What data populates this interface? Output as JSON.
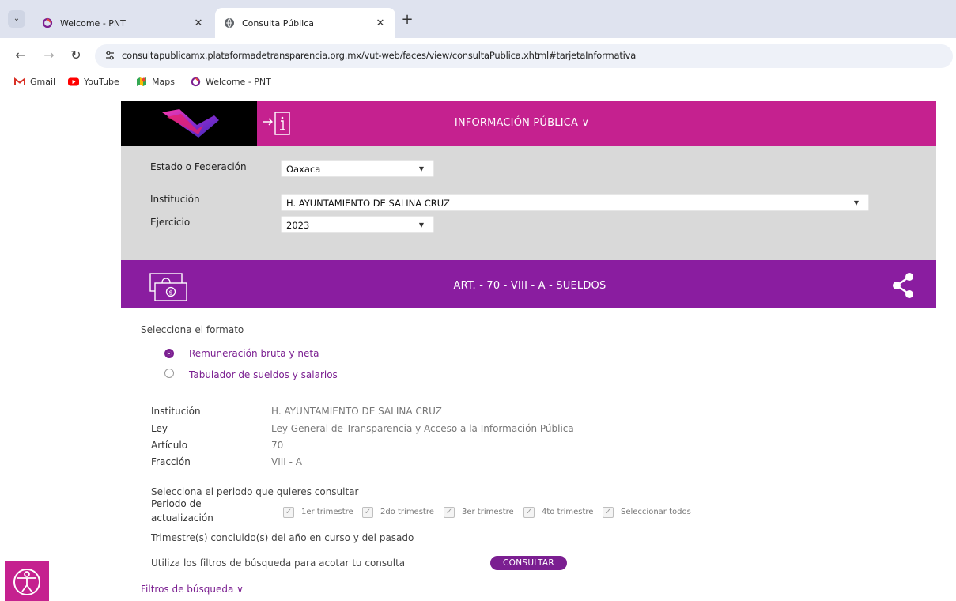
{
  "browser": {
    "tabs": [
      {
        "title": "Welcome - PNT",
        "active": false
      },
      {
        "title": "Consulta Pública",
        "active": true
      }
    ],
    "new_tab": "+",
    "url": "consultapublicamx.plataformadetransparencia.org.mx/vut-web/faces/view/consultaPublica.xhtml#tarjetaInformativa",
    "bookmarks": [
      "Gmail",
      "YouTube",
      "Maps",
      "Welcome - PNT"
    ]
  },
  "header": {
    "title": "INFORMACIÓN PÚBLICA ∨"
  },
  "filters": {
    "estado_label": "Estado o Federación",
    "estado_value": "Oaxaca",
    "institucion_label": "Institución",
    "institucion_value": "H. AYUNTAMIENTO DE SALINA CRUZ",
    "ejercicio_label": "Ejercicio",
    "ejercicio_value": "2023"
  },
  "section": {
    "title": "ART. - 70 - VIII - A - SUELDOS"
  },
  "format": {
    "prompt": "Selecciona el formato",
    "options": [
      {
        "label": "Remuneración bruta y neta",
        "selected": true
      },
      {
        "label": "Tabulador de sueldos y salarios",
        "selected": false
      }
    ]
  },
  "details": [
    {
      "label": "Institución",
      "value": "H. AYUNTAMIENTO DE SALINA CRUZ"
    },
    {
      "label": "Ley",
      "value": "Ley General de Transparencia y Acceso a la Información Pública"
    },
    {
      "label": "Artículo",
      "value": "70"
    },
    {
      "label": "Fracción",
      "value": "VIII - A"
    }
  ],
  "period": {
    "prompt": "Selecciona el periodo que quieres consultar",
    "label_line1": "Periodo de",
    "label_line2": "actualización",
    "options": [
      "1er trimestre",
      "2do trimestre",
      "3er trimestre",
      "4to trimestre",
      "Seleccionar todos"
    ],
    "note": "Trimestre(s) concluido(s) del año en curso y del pasado"
  },
  "search": {
    "hint": "Utiliza los filtros de búsqueda para acotar tu consulta",
    "button": "CONSULTAR",
    "filters_link": "Filtros de búsqueda ∨"
  },
  "colors": {
    "magenta": "#c5218f",
    "purple": "#8a1da0",
    "accent": "#7b1f91",
    "panel_gray": "#d9d9d9"
  }
}
